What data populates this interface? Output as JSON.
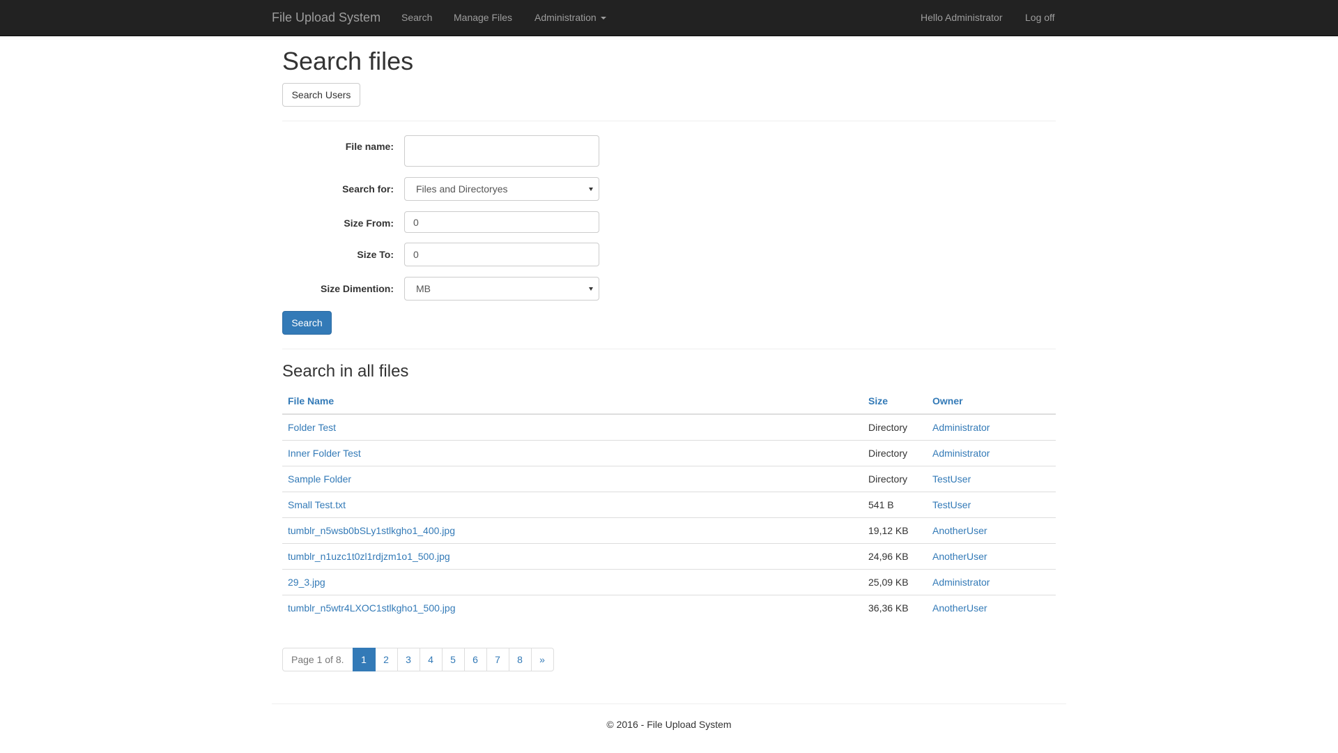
{
  "navbar": {
    "brand": "File Upload System",
    "items": [
      {
        "label": "Search"
      },
      {
        "label": "Manage Files"
      },
      {
        "label": "Administration"
      }
    ],
    "greeting": "Hello Administrator",
    "logoff": "Log off"
  },
  "page": {
    "title": "Search files",
    "search_users_button": "Search Users"
  },
  "form": {
    "file_name_label": "File name:",
    "file_name_value": "",
    "search_for_label": "Search for:",
    "search_for_value": "Files and Directoryes",
    "size_from_label": "Size From:",
    "size_from_value": "0",
    "size_to_label": "Size To:",
    "size_to_value": "0",
    "size_dimention_label": "Size Dimention:",
    "size_dimention_value": "MB",
    "search_button": "Search"
  },
  "results": {
    "title": "Search in all files",
    "columns": [
      "File Name",
      "Size",
      "Owner"
    ],
    "rows": [
      {
        "name": "Folder Test",
        "size": "Directory",
        "owner": "Administrator"
      },
      {
        "name": "Inner Folder Test",
        "size": "Directory",
        "owner": "Administrator"
      },
      {
        "name": "Sample Folder",
        "size": "Directory",
        "owner": "TestUser"
      },
      {
        "name": "Small Test.txt",
        "size": "541 B",
        "owner": "TestUser"
      },
      {
        "name": "tumblr_n5wsb0bSLy1stlkgho1_400.jpg",
        "size": "19,12 KB",
        "owner": "AnotherUser"
      },
      {
        "name": "tumblr_n1uzc1t0zl1rdjzm1o1_500.jpg",
        "size": "24,96 KB",
        "owner": "AnotherUser"
      },
      {
        "name": "29_3.jpg",
        "size": "25,09 KB",
        "owner": "Administrator"
      },
      {
        "name": "tumblr_n5wtr4LXOC1stlkgho1_500.jpg",
        "size": "36,36 KB",
        "owner": "AnotherUser"
      }
    ]
  },
  "pagination": {
    "info": "Page 1 of 8.",
    "pages": [
      "1",
      "2",
      "3",
      "4",
      "5",
      "6",
      "7",
      "8"
    ],
    "next": "»",
    "current": "1"
  },
  "footer": {
    "text": "© 2016 - File Upload System"
  },
  "colors": {
    "navbar_bg": "#222222",
    "link": "#337ab7",
    "primary": "#337ab7"
  }
}
